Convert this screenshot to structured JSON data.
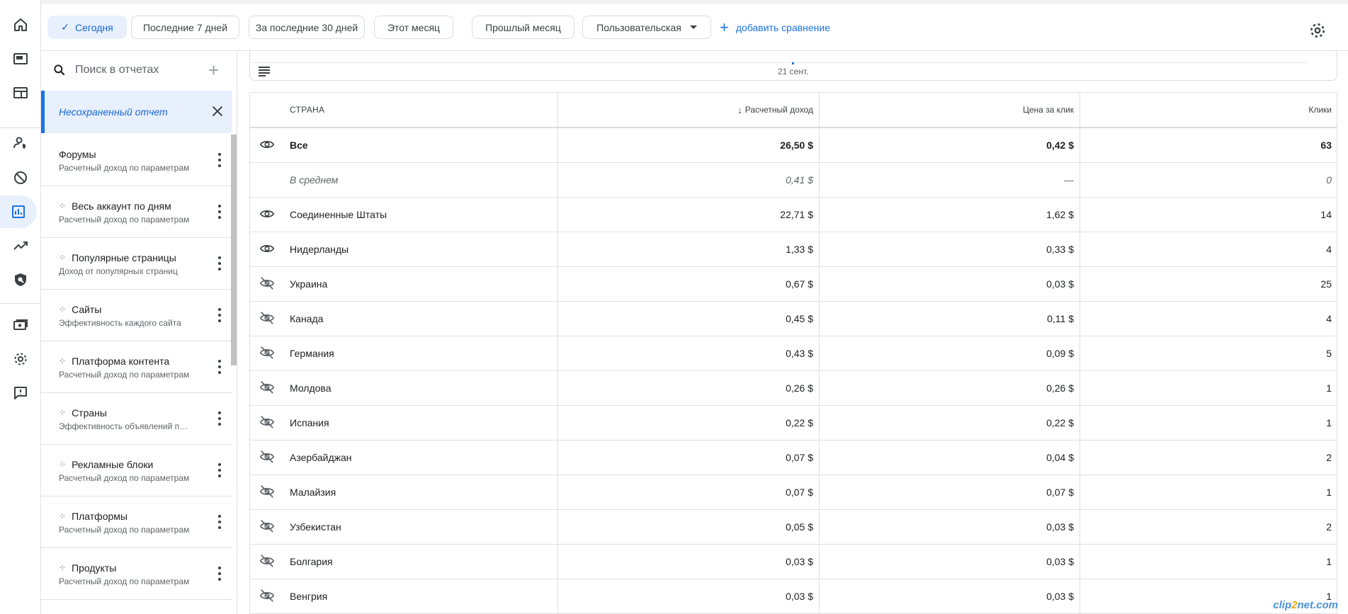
{
  "rail": {
    "items": [
      {
        "icon": "home-icon"
      },
      {
        "icon": "sites-icon"
      },
      {
        "icon": "ads-layout-icon"
      },
      {
        "icon": "privacy-user-icon"
      },
      {
        "icon": "block-icon"
      },
      {
        "icon": "reports-icon",
        "active": true
      },
      {
        "icon": "trending-icon"
      },
      {
        "icon": "policy-shield-icon"
      },
      {
        "icon": "payments-icon"
      },
      {
        "icon": "settings-icon"
      },
      {
        "icon": "feedback-icon"
      }
    ]
  },
  "filters": {
    "chips": [
      {
        "label": "Сегодня",
        "selected": true
      },
      {
        "label": "Последние 7 дней"
      },
      {
        "label": "За последние 30 дней"
      },
      {
        "label": "Этот месяц"
      },
      {
        "label": "Прошлый месяц"
      },
      {
        "label": "Пользовательская",
        "dropdown": true
      }
    ],
    "add_compare": "добавить сравнение"
  },
  "sidebar": {
    "search_placeholder": "Поиск в отчетах",
    "unsaved_label": "Несохраненный отчет",
    "reports": [
      {
        "name": "Форумы",
        "desc": "Расчетный доход по параметрам",
        "spark": false
      },
      {
        "name": "Весь аккаунт по дням",
        "desc": "Расчетный доход по параметрам",
        "spark": true
      },
      {
        "name": "Популярные страницы",
        "desc": "Доход от популярных страниц",
        "spark": true
      },
      {
        "name": "Сайты",
        "desc": "Эффективность каждого сайта",
        "spark": true
      },
      {
        "name": "Платформа контента",
        "desc": "Расчетный доход по параметрам",
        "spark": true
      },
      {
        "name": "Страны",
        "desc": "Эффективность объявлений по странам",
        "spark": true
      },
      {
        "name": "Рекламные блоки",
        "desc": "Расчетный доход по параметрам",
        "spark": true
      },
      {
        "name": "Платформы",
        "desc": "Расчетный доход по параметрам",
        "spark": true
      },
      {
        "name": "Продукты",
        "desc": "Расчетный доход по параметрам",
        "spark": true
      }
    ]
  },
  "chart": {
    "date_label": "21 сент."
  },
  "table": {
    "headers": {
      "name": "Страна",
      "revenue": "Расчетный доход",
      "cpc": "Цена за клик",
      "clicks": "Клики"
    },
    "rows": [
      {
        "name": "Все",
        "revenue": "26,50 $",
        "cpc": "0,42 $",
        "clicks": "63",
        "kind": "total",
        "visible": true
      },
      {
        "name": "В среднем",
        "revenue": "0,41 $",
        "cpc": "—",
        "clicks": "0",
        "kind": "avg"
      },
      {
        "name": "Соединенные Штаты",
        "revenue": "22,71 $",
        "cpc": "1,62 $",
        "clicks": "14",
        "visible": true
      },
      {
        "name": "Нидерланды",
        "revenue": "1,33 $",
        "cpc": "0,33 $",
        "clicks": "4",
        "visible": true
      },
      {
        "name": "Украина",
        "revenue": "0,67 $",
        "cpc": "0,03 $",
        "clicks": "25",
        "visible": false
      },
      {
        "name": "Канада",
        "revenue": "0,45 $",
        "cpc": "0,11 $",
        "clicks": "4",
        "visible": false
      },
      {
        "name": "Германия",
        "revenue": "0,43 $",
        "cpc": "0,09 $",
        "clicks": "5",
        "visible": false
      },
      {
        "name": "Молдова",
        "revenue": "0,26 $",
        "cpc": "0,26 $",
        "clicks": "1",
        "visible": false
      },
      {
        "name": "Испания",
        "revenue": "0,22 $",
        "cpc": "0,22 $",
        "clicks": "1",
        "visible": false
      },
      {
        "name": "Азербайджан",
        "revenue": "0,07 $",
        "cpc": "0,04 $",
        "clicks": "2",
        "visible": false
      },
      {
        "name": "Малайзия",
        "revenue": "0,07 $",
        "cpc": "0,07 $",
        "clicks": "1",
        "visible": false
      },
      {
        "name": "Узбекистан",
        "revenue": "0,05 $",
        "cpc": "0,03 $",
        "clicks": "2",
        "visible": false
      },
      {
        "name": "Болгария",
        "revenue": "0,03 $",
        "cpc": "0,03 $",
        "clicks": "1",
        "visible": false
      },
      {
        "name": "Венгрия",
        "revenue": "0,03 $",
        "cpc": "0,03 $",
        "clicks": "1",
        "visible": false
      }
    ]
  },
  "watermark": {
    "pre": "clip",
    "mid": "2",
    "post": "net.com"
  },
  "colors": {
    "accent": "#1a73e8",
    "selected_bg": "#e8f0fe",
    "border": "#e0e0e0"
  }
}
